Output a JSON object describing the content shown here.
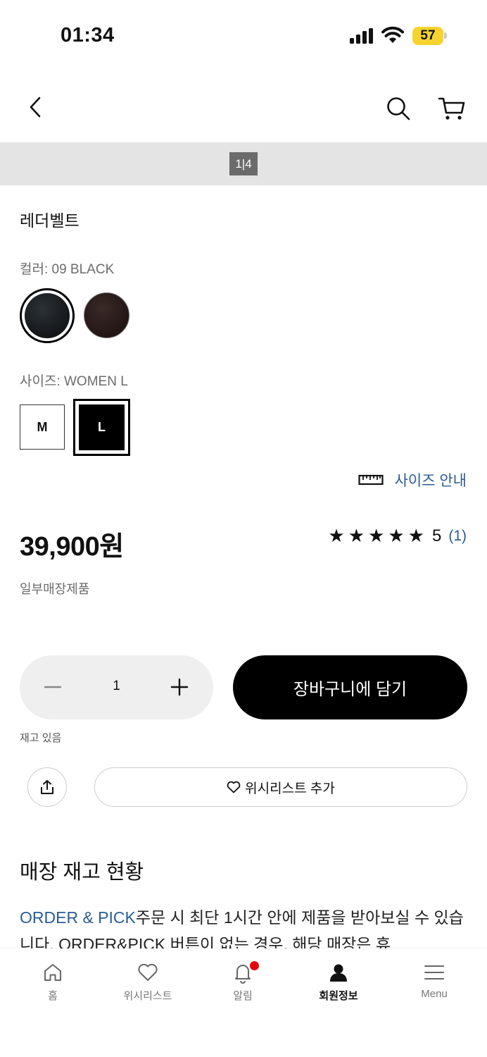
{
  "status_bar": {
    "time": "01:34",
    "battery": "57"
  },
  "gallery": {
    "page_current": "1",
    "page_total": "4"
  },
  "product": {
    "name": "레더벨트",
    "color_label": "컬러: 09 BLACK",
    "colors": [
      {
        "name": "black-swatch",
        "selected": true
      },
      {
        "name": "brown-swatch",
        "selected": false
      }
    ],
    "size_label": "사이즈: WOMEN L",
    "sizes": [
      {
        "label": "M",
        "selected": false
      },
      {
        "label": "L",
        "selected": true
      }
    ],
    "size_guide": "사이즈 안내",
    "price": "39,900원",
    "rating": {
      "stars": "★★★★★",
      "score": "5",
      "count": "(1)"
    },
    "availability": "일부매장제품"
  },
  "purchase": {
    "quantity": "1",
    "add_to_cart": "장바구니에 담기",
    "stock_status": "재고 있음",
    "wishlist": "위시리스트 추가"
  },
  "store": {
    "heading": "매장 재고 현황",
    "link_text": "ORDER & PICK",
    "description": "주문 시 최단 1시간 안에 제품을 받아보실 수 있습니다. ORDER&PICK 버튼이 없는 경우, 해당 매장은 휴"
  },
  "tabs": [
    {
      "label": "홈",
      "icon": "home-icon"
    },
    {
      "label": "위시리스트",
      "icon": "heart-icon"
    },
    {
      "label": "알림",
      "icon": "bell-icon"
    },
    {
      "label": "회원정보",
      "icon": "person-icon"
    },
    {
      "label": "Menu",
      "icon": "menu-icon"
    }
  ],
  "colors": {
    "link": "#2a5d96",
    "battery": "#f7d32f",
    "badge": "#e4060f"
  }
}
